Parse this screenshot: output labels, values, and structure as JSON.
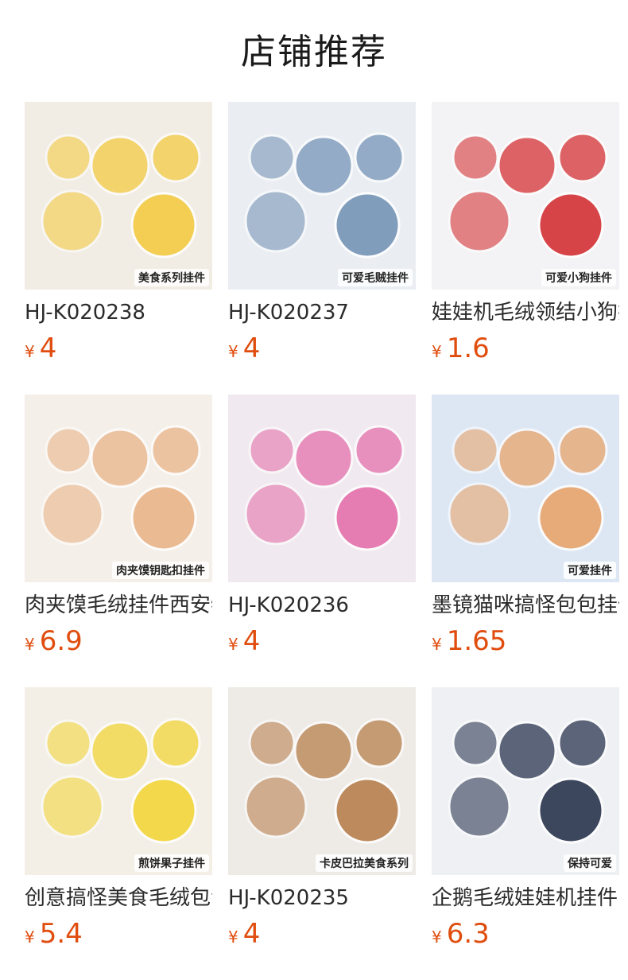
{
  "header": {
    "title": "店铺推荐"
  },
  "currency": "¥",
  "products": [
    {
      "name": "HJ-K020238",
      "price": "4",
      "tag": "美食系列挂件",
      "bg": "#f1ece4",
      "accent": "#f5c93a"
    },
    {
      "name": "HJ-K020237",
      "price": "4",
      "tag": "可爱毛贼挂件",
      "bg": "#eaeef3",
      "accent": "#6f8fb3"
    },
    {
      "name": "娃娃机毛绒领结小狗挂件",
      "price": "1.6",
      "tag": "可爱小狗挂件",
      "bg": "#f3f2f4",
      "accent": "#d3262a"
    },
    {
      "name": "肉夹馍毛绒挂件西安特色",
      "price": "6.9",
      "tag": "肉夹馍钥匙扣挂件",
      "bg": "#f4efe8",
      "accent": "#e9b184"
    },
    {
      "name": "HJ-K020236",
      "price": "4",
      "tag": "",
      "bg": "#f0e9ef",
      "accent": "#e46aa8"
    },
    {
      "name": "墨镜猫咪搞怪包包挂件",
      "price": "1.65",
      "tag": "可爱挂件",
      "bg": "#dde7f4",
      "accent": "#e9a064"
    },
    {
      "name": "创意搞怪美食毛绒包包挂件",
      "price": "5.4",
      "tag": "煎饼果子挂件",
      "bg": "#f3efe6",
      "accent": "#f4d431"
    },
    {
      "name": "HJ-K020235",
      "price": "4",
      "tag": "卡皮巴拉美食系列",
      "bg": "#eeeae6",
      "accent": "#b47a45"
    },
    {
      "name": "企鹅毛绒娃娃机挂件",
      "price": "6.3",
      "tag": "保持可爱",
      "bg": "#eef0f4",
      "accent": "#1e2a44"
    }
  ]
}
